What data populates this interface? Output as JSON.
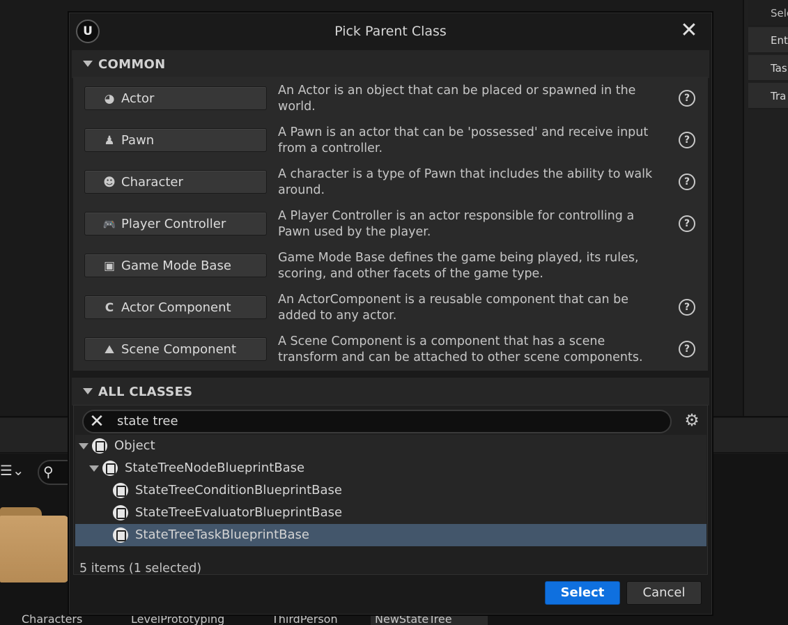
{
  "background": {
    "right_panel_rows": [
      "Sele",
      "Ent",
      "Tas",
      "Tra"
    ],
    "folders": [
      "Characters",
      "LevelPrototyping",
      "ThirdPerson",
      "NewStateTree"
    ]
  },
  "dialog": {
    "title": "Pick Parent Class",
    "logo_text": "U",
    "close_glyph": "✕"
  },
  "common": {
    "header": "COMMON",
    "classes": [
      {
        "label": "Actor",
        "icon": "actor-icon",
        "glyph": "◕",
        "description": "An Actor is an object that can be placed or spawned in the world.",
        "help": true
      },
      {
        "label": "Pawn",
        "icon": "pawn-icon",
        "glyph": "♟",
        "description": "A Pawn is an actor that can be 'possessed' and receive input from a controller.",
        "help": true
      },
      {
        "label": "Character",
        "icon": "character-icon",
        "glyph": "☻",
        "description": "A character is a type of Pawn that includes the ability to walk around.",
        "help": true
      },
      {
        "label": "Player Controller",
        "icon": "gamepad-icon",
        "glyph": "🎮",
        "description": "A Player Controller is an actor responsible for controlling a Pawn used by the player.",
        "help": true
      },
      {
        "label": "Game Mode Base",
        "icon": "game-mode-icon",
        "glyph": "▣",
        "description": "Game Mode Base defines the game being played, its rules, scoring, and other facets of the game type.",
        "help": false
      },
      {
        "label": "Actor Component",
        "icon": "actor-component-icon",
        "glyph": "C",
        "description": "An ActorComponent is a reusable component that can be added to any actor.",
        "help": true
      },
      {
        "label": "Scene Component",
        "icon": "scene-component-icon",
        "glyph": "⛰",
        "description": "A Scene Component is a component that has a scene transform and can be attached to other scene components.",
        "help": true
      }
    ],
    "help_glyph": "?"
  },
  "all_classes": {
    "header": "ALL CLASSES",
    "search_value": "state tree",
    "clear_glyph": "✕",
    "settings_glyph": "⚙",
    "tree": [
      {
        "label": "Object",
        "depth": 0,
        "expanded": true,
        "selected": false
      },
      {
        "label": "StateTreeNodeBlueprintBase",
        "depth": 1,
        "expanded": true,
        "selected": false
      },
      {
        "label": "StateTreeConditionBlueprintBase",
        "depth": 2,
        "expanded": false,
        "selected": false
      },
      {
        "label": "StateTreeEvaluatorBlueprintBase",
        "depth": 2,
        "expanded": false,
        "selected": false
      },
      {
        "label": "StateTreeTaskBlueprintBase",
        "depth": 2,
        "expanded": false,
        "selected": true
      }
    ],
    "items_count": "5 items (1 selected)"
  },
  "buttons": {
    "select": "Select",
    "cancel": "Cancel"
  },
  "colors": {
    "accent": "#0f70df",
    "selection": "#43566b"
  }
}
